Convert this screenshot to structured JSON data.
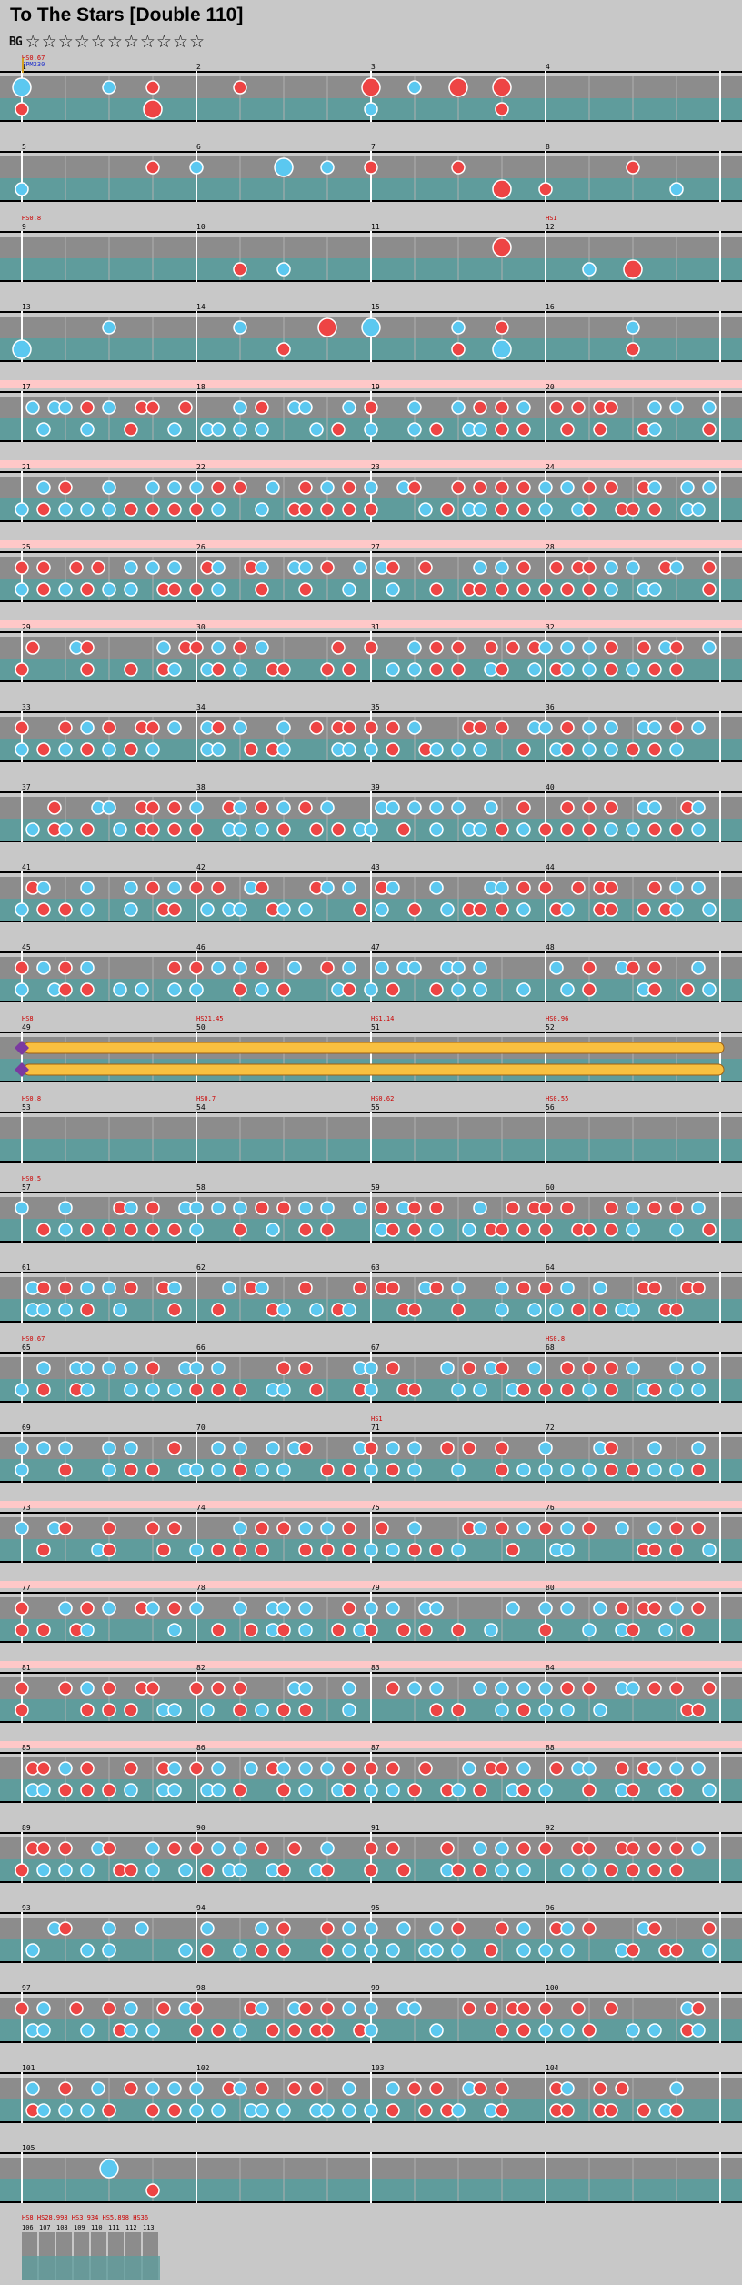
{
  "title": "To The Stars [Double 110]",
  "difficulty": {
    "logo": "BG",
    "stars": "☆☆☆☆☆☆☆☆☆☆☆"
  },
  "colors": {
    "background": "#c8c8c8",
    "lane_gray": "#8c8c8c",
    "lane_teal": "#5f9c9c",
    "note_blue": "#5bc8f0",
    "note_red": "#ee4444",
    "long_note": "#f8c040",
    "peak": "#ffc8c8",
    "speed_label": "#cc0000",
    "bpm_label": "#2233cc"
  },
  "chart_data": {
    "type": "rhythm-game-note-chart",
    "mode": "Double",
    "level": 110,
    "measure_count": 105,
    "speed_labels": [
      {
        "measure": 1,
        "text": "HS0.67"
      },
      {
        "measure": 9,
        "text": "HS0.8"
      },
      {
        "measure": 12,
        "text": "HS1"
      },
      {
        "measure": 49,
        "text": "HS8"
      },
      {
        "measure": 50,
        "text": "HS21.45"
      },
      {
        "measure": 51,
        "text": "HS1.14"
      },
      {
        "measure": 52,
        "text": "HS0.96"
      },
      {
        "measure": 53,
        "text": "HS0.8"
      },
      {
        "measure": 54,
        "text": "HS0.7"
      },
      {
        "measure": 55,
        "text": "HS0.62"
      },
      {
        "measure": 56,
        "text": "HS0.55"
      },
      {
        "measure": 57,
        "text": "HS0.5"
      },
      {
        "measure": 65,
        "text": "HS0.67"
      },
      {
        "measure": 68,
        "text": "HS0.8"
      },
      {
        "measure": 71,
        "text": "HS1"
      }
    ],
    "bpm_labels": [
      {
        "measure": 1,
        "text": "BPM230"
      }
    ],
    "footer": {
      "speeds": "HS8 HS28.998 HS3.934 HS5.898 HS36",
      "measures": [
        "106",
        "107",
        "108",
        "109",
        "110",
        "111",
        "112",
        "113"
      ]
    }
  }
}
